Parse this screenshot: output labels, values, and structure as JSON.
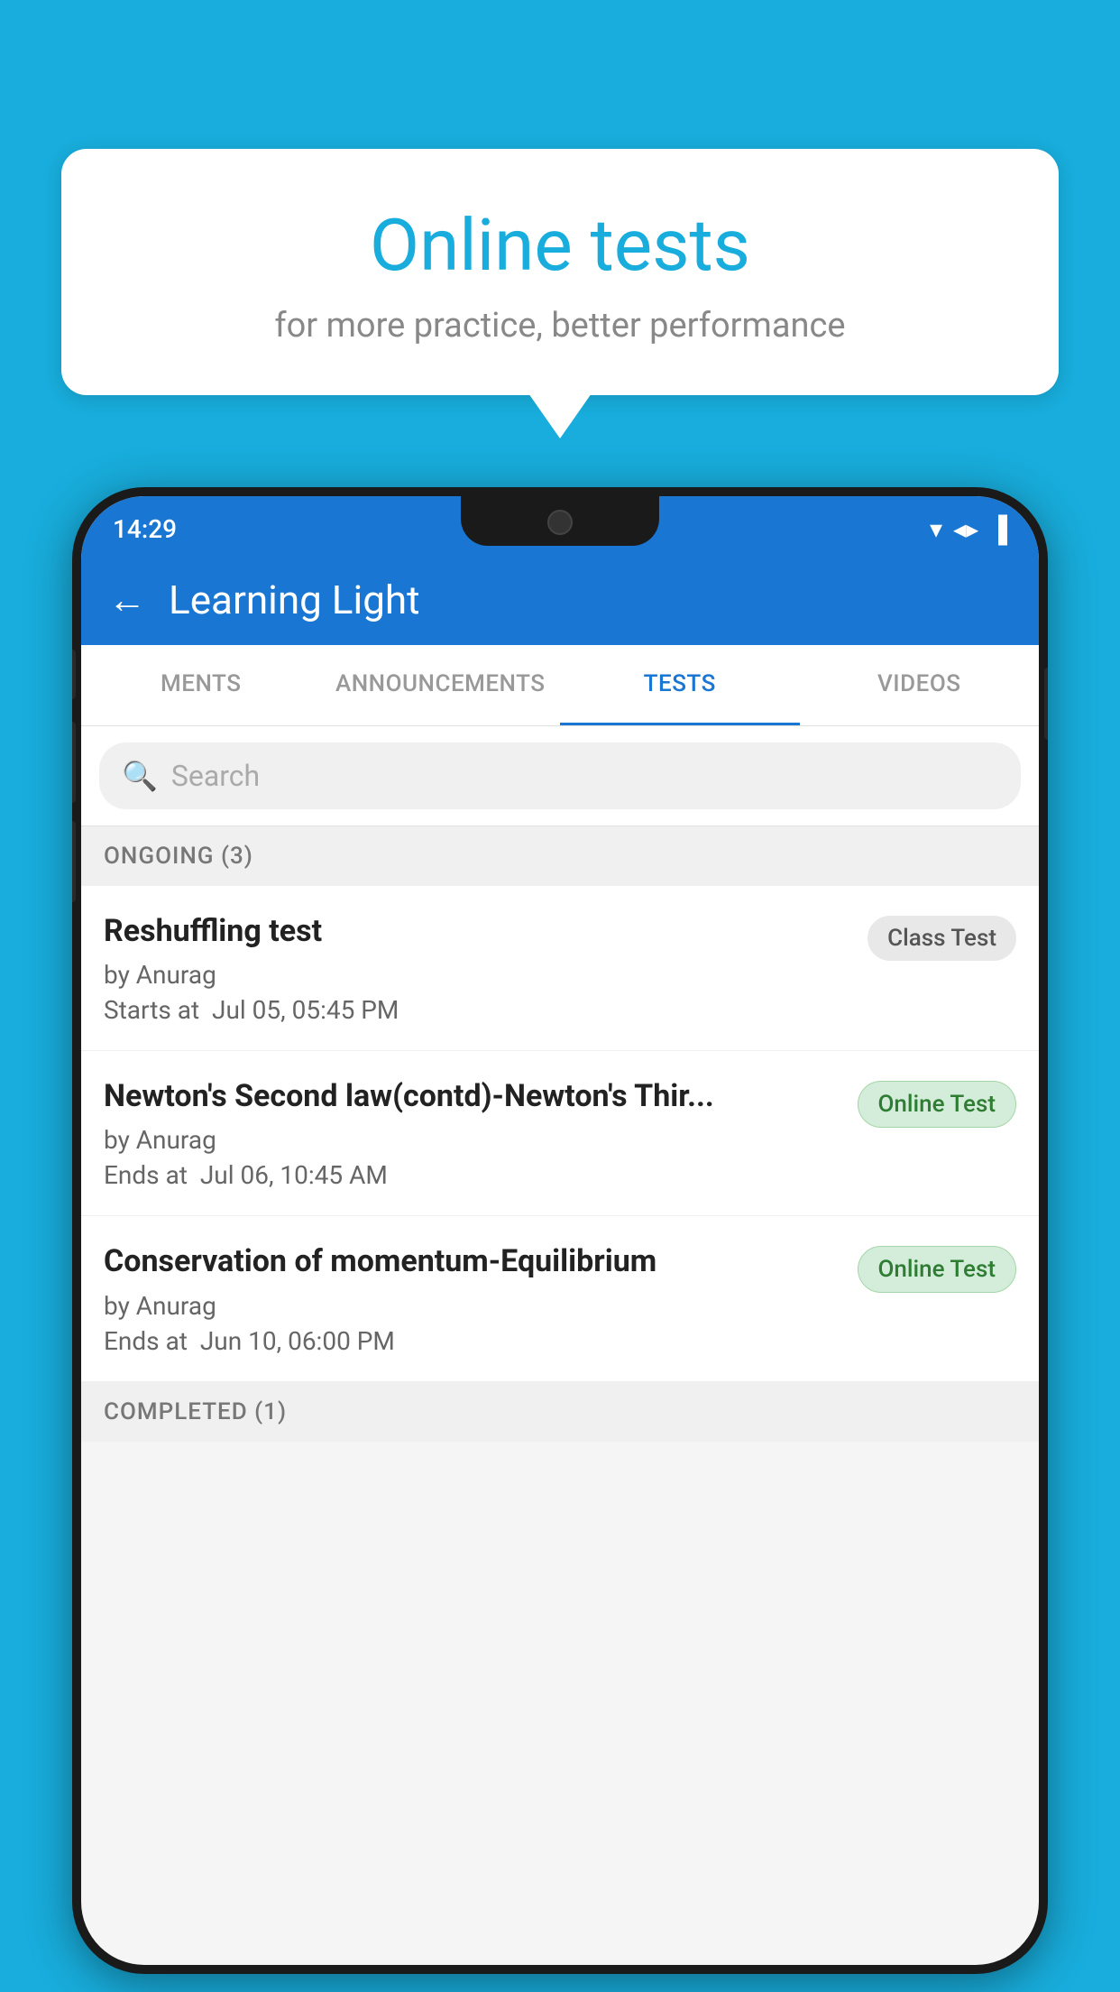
{
  "background_color": "#18ADDC",
  "bubble": {
    "title": "Online tests",
    "subtitle": "for more practice, better performance"
  },
  "status_bar": {
    "time": "14:29",
    "wifi": "▼",
    "signal": "▲",
    "battery": "▐"
  },
  "header": {
    "back_label": "←",
    "title": "Learning Light"
  },
  "tabs": [
    {
      "label": "MENTS",
      "active": false
    },
    {
      "label": "ANNOUNCEMENTS",
      "active": false
    },
    {
      "label": "TESTS",
      "active": true
    },
    {
      "label": "VIDEOS",
      "active": false
    }
  ],
  "search": {
    "placeholder": "Search"
  },
  "sections": {
    "ongoing_label": "ONGOING (3)",
    "completed_label": "COMPLETED (1)"
  },
  "tests": [
    {
      "name": "Reshuffling test",
      "author": "by Anurag",
      "date_label": "Starts at",
      "date": "Jul 05, 05:45 PM",
      "badge": "Class Test",
      "badge_type": "class"
    },
    {
      "name": "Newton's Second law(contd)-Newton's Thir...",
      "author": "by Anurag",
      "date_label": "Ends at",
      "date": "Jul 06, 10:45 AM",
      "badge": "Online Test",
      "badge_type": "online"
    },
    {
      "name": "Conservation of momentum-Equilibrium",
      "author": "by Anurag",
      "date_label": "Ends at",
      "date": "Jun 10, 06:00 PM",
      "badge": "Online Test",
      "badge_type": "online"
    }
  ]
}
